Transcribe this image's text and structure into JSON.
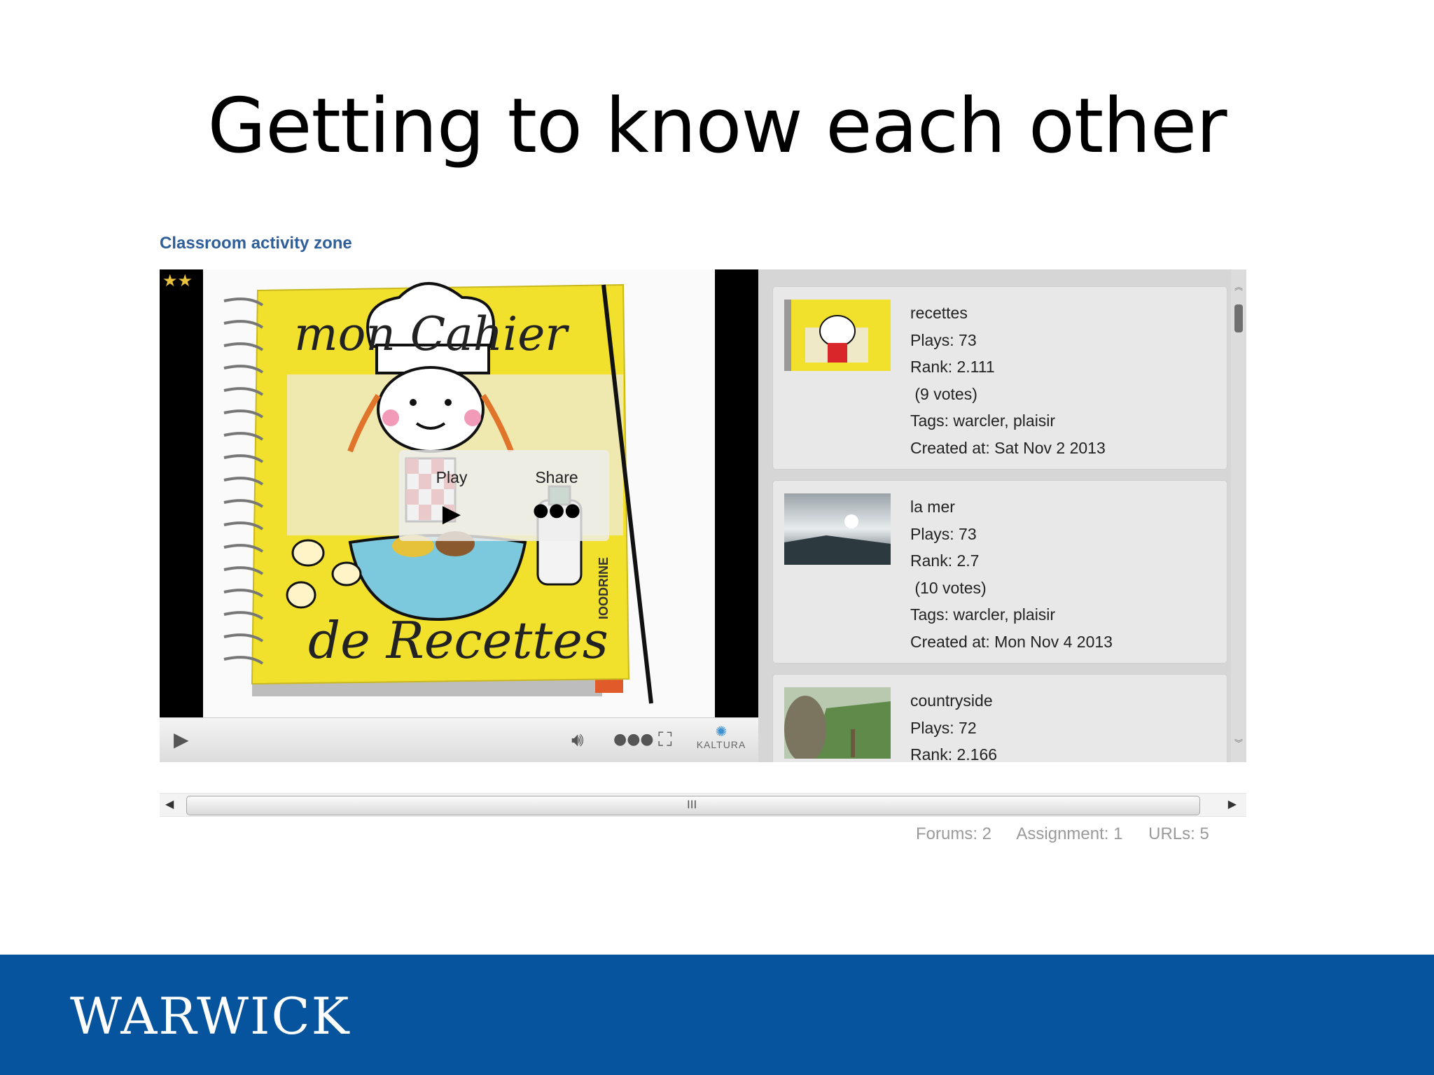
{
  "slide": {
    "title": "Getting to know each other"
  },
  "zone": {
    "label": "Classroom activity zone"
  },
  "player": {
    "rating_stars": "★★",
    "overlay": {
      "play_label": "Play",
      "share_label": "Share"
    },
    "artwork": {
      "line1": "mon Cahier",
      "line2": "de Recettes",
      "brand": "IOODRINE"
    },
    "controls": {
      "play_icon": "play-icon",
      "volume_icon": "volume-icon",
      "share_icon": "share-icon",
      "fullscreen_icon": "fullscreen-icon",
      "brand": "KALTURA"
    }
  },
  "playlist": {
    "entries": [
      {
        "title": "recettes",
        "plays": "Plays: 73",
        "rank": "Rank: 2.111",
        "votes": " (9 votes)",
        "tags": "Tags: warcler, plaisir",
        "created": "Created at: Sat Nov 2 2013"
      },
      {
        "title": "la mer",
        "plays": "Plays: 73",
        "rank": "Rank: 2.7",
        "votes": " (10 votes)",
        "tags": "Tags: warcler, plaisir",
        "created": "Created at: Mon Nov 4 2013"
      },
      {
        "title": "countryside",
        "plays": "Plays: 72",
        "rank": "Rank: 2.166"
      }
    ]
  },
  "hscroll": {
    "grip": "III"
  },
  "stats": {
    "forums": "Forums: 2",
    "assignment": "Assignment: 1",
    "urls": "URLs: 5"
  },
  "footer": {
    "logo": "WARWICK"
  },
  "colors": {
    "footer_bg": "#07549e",
    "zone_label": "#2f5f9a",
    "notebook_yellow": "#f2e12c"
  }
}
